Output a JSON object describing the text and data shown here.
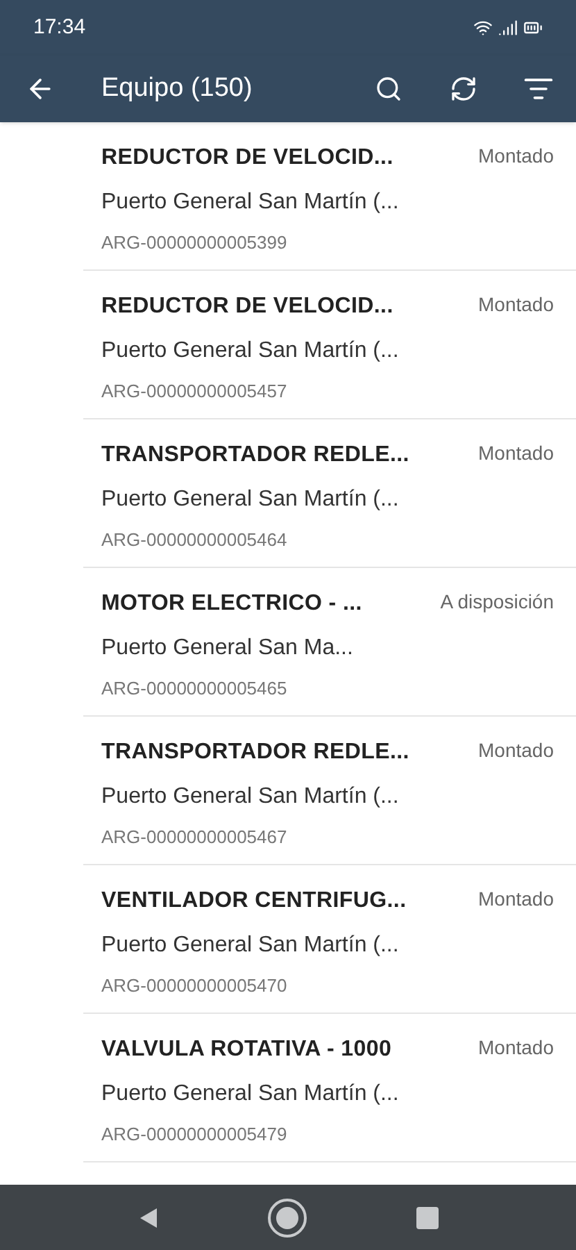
{
  "status_bar": {
    "time": "17:34"
  },
  "app_bar": {
    "title": "Equipo (150)"
  },
  "items": [
    {
      "title": "REDUCTOR DE VELOCID...",
      "location": "Puerto General San Martín (...",
      "id": "ARG-00000000005399",
      "status": "Montado"
    },
    {
      "title": "REDUCTOR DE VELOCID...",
      "location": "Puerto General San Martín (...",
      "id": "ARG-00000000005457",
      "status": "Montado"
    },
    {
      "title": "TRANSPORTADOR REDLE...",
      "location": "Puerto General San Martín (...",
      "id": "ARG-00000000005464",
      "status": "Montado"
    },
    {
      "title": "MOTOR ELECTRICO - ...",
      "location": "Puerto General San Ma...",
      "id": "ARG-00000000005465",
      "status": "A disposición"
    },
    {
      "title": "TRANSPORTADOR REDLE...",
      "location": "Puerto General San Martín (...",
      "id": "ARG-00000000005467",
      "status": "Montado"
    },
    {
      "title": "VENTILADOR CENTRIFUG...",
      "location": "Puerto General San Martín (...",
      "id": "ARG-00000000005470",
      "status": "Montado"
    },
    {
      "title": "VALVULA ROTATIVA - 1000",
      "location": "Puerto General San Martín (...",
      "id": "ARG-00000000005479",
      "status": "Montado"
    }
  ]
}
